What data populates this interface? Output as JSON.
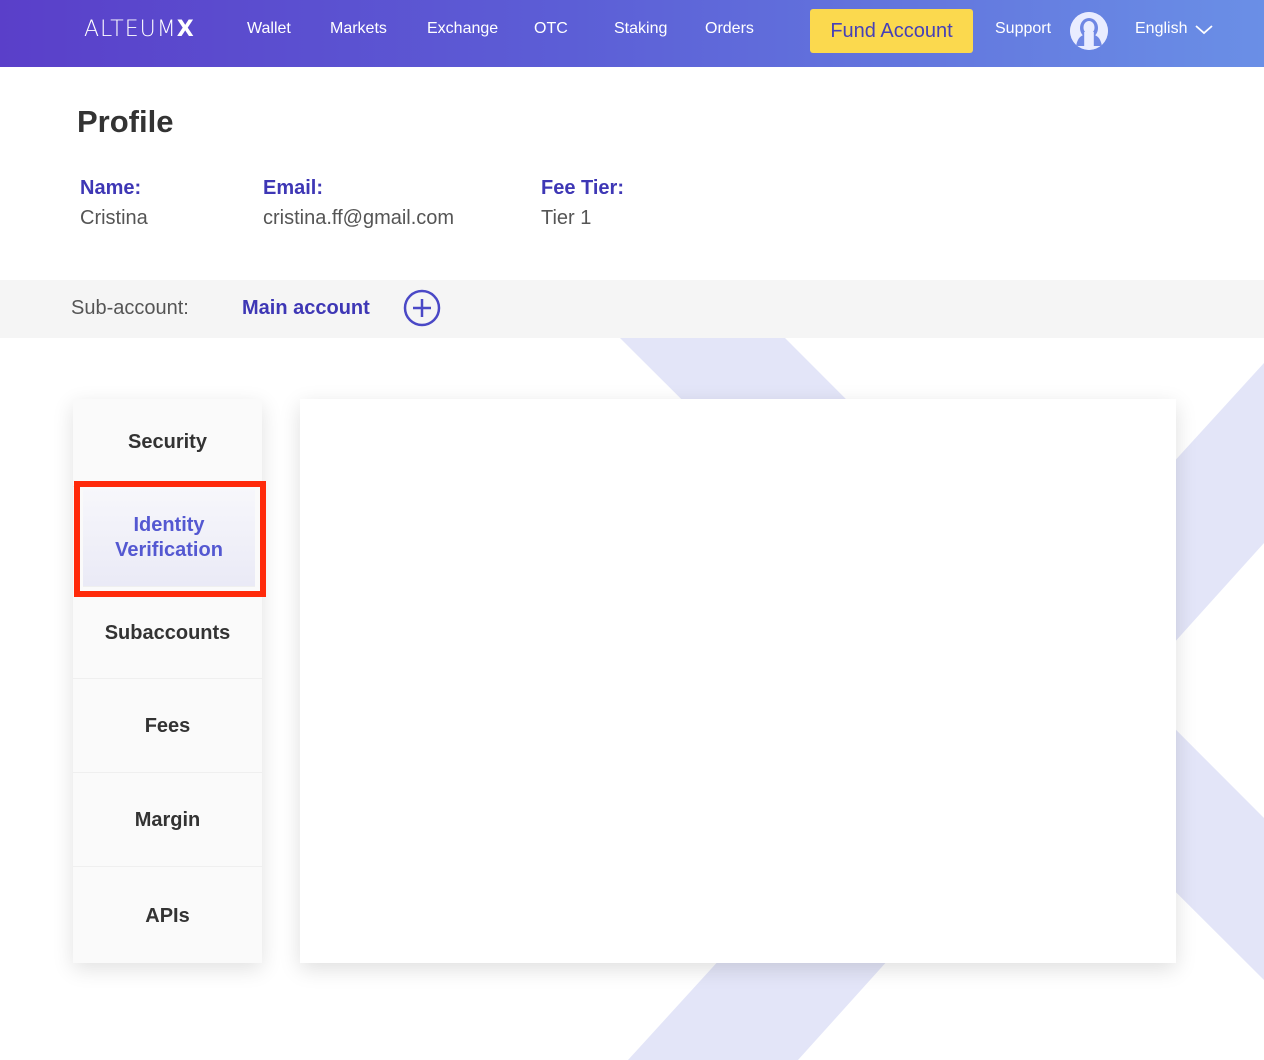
{
  "brand": {
    "name_main": "ALTEUM",
    "name_x": "X"
  },
  "nav": {
    "items": [
      "Wallet",
      "Markets",
      "Exchange",
      "OTC",
      "Staking",
      "Orders"
    ],
    "fund_button": "Fund Account",
    "support": "Support",
    "language": "English"
  },
  "profile": {
    "title": "Profile",
    "fields": [
      {
        "label": "Name:",
        "value": "Cristina"
      },
      {
        "label": "Email:",
        "value": "cristina.ff@gmail.com"
      },
      {
        "label": "Fee Tier:",
        "value": "Tier 1"
      }
    ]
  },
  "subaccount": {
    "label": "Sub-account:",
    "current": "Main account"
  },
  "tabs": [
    {
      "label": "Security",
      "active": false
    },
    {
      "label": "Identity Verification",
      "active": true
    },
    {
      "label": "Subaccounts",
      "active": false
    },
    {
      "label": "Fees",
      "active": false
    },
    {
      "label": "Margin",
      "active": false
    },
    {
      "label": "APIs",
      "active": false
    }
  ],
  "colors": {
    "accent": "#3e37b5",
    "fund_button_bg": "#fbd94e",
    "highlight": "#ff2a0a",
    "decor_stripe": "#e3e5f8"
  },
  "icons": {
    "avatar": "user-avatar-icon",
    "language": "chevron-down-icon",
    "add_subaccount": "plus-circle-icon"
  }
}
